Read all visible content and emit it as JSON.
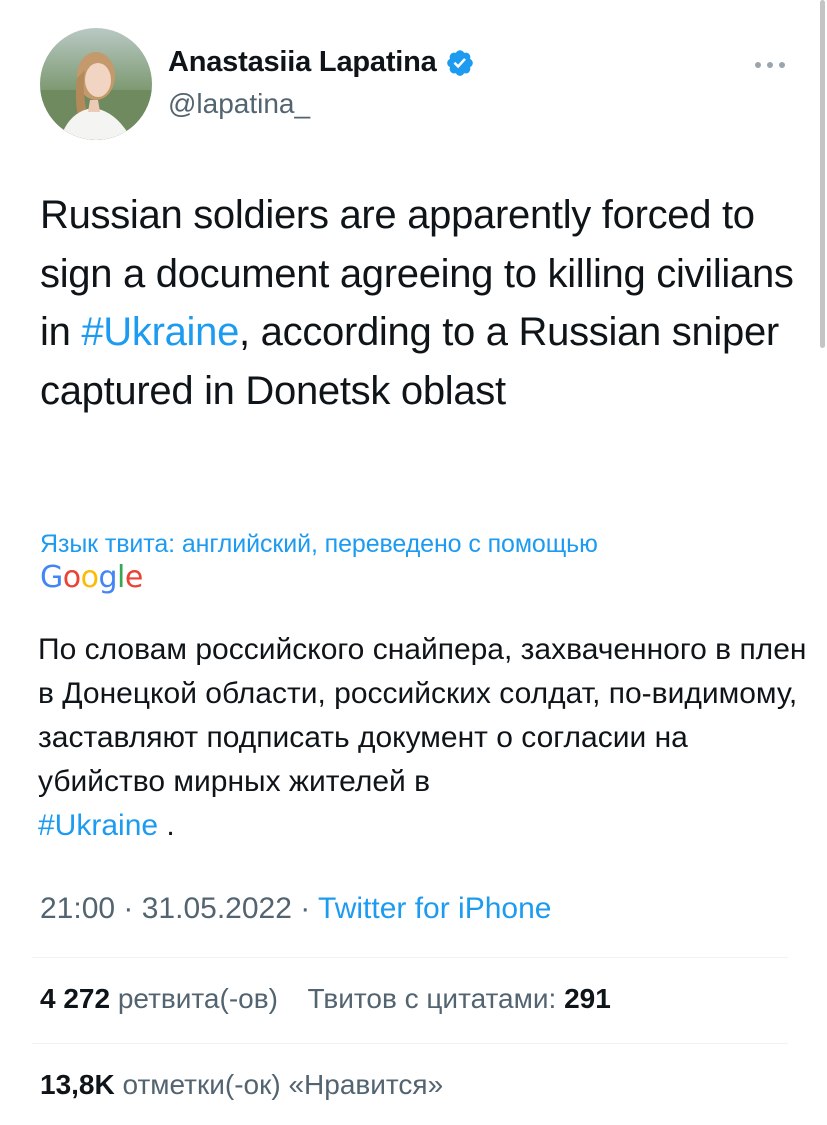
{
  "author": {
    "display_name": "Anastasiia Lapatina",
    "handle": "@lapatina_",
    "verified_icon": "verified-badge-icon"
  },
  "menu_icon": "more-horizontal-icon",
  "tweet": {
    "text_part1": "Russian soldiers are apparently forced to sign a document agreeing to killing civilians in ",
    "hashtag": "#Ukraine",
    "text_part2": ", according to a Russian sniper captured in Donetsk oblast"
  },
  "translation": {
    "note": "Язык твита: английский, переведено с помощью",
    "provider": "Google",
    "text": "По словам российского снайпера, захваченного в плен в Донецкой области, российских солдат, по-видимому, заставляют подписать документ о согласии на убийство мирных жителей в",
    "hashtag": "#Ukraine",
    "suffix": " ."
  },
  "meta": {
    "time": "21:00",
    "separator1": " · ",
    "date": "31.05.2022",
    "separator2": " · ",
    "source": "Twitter for iPhone"
  },
  "stats": {
    "retweets_count": "4 272",
    "retweets_label": " ретвита(-ов)",
    "quotes_label": "Твитов с цитатами:",
    "quotes_count": "291",
    "likes_count": "13,8K",
    "likes_label": " отметки(-ок) «Нравится»"
  },
  "colors": {
    "accent": "#1d9bf0",
    "text": "#0f1419",
    "secondary": "#536471"
  }
}
